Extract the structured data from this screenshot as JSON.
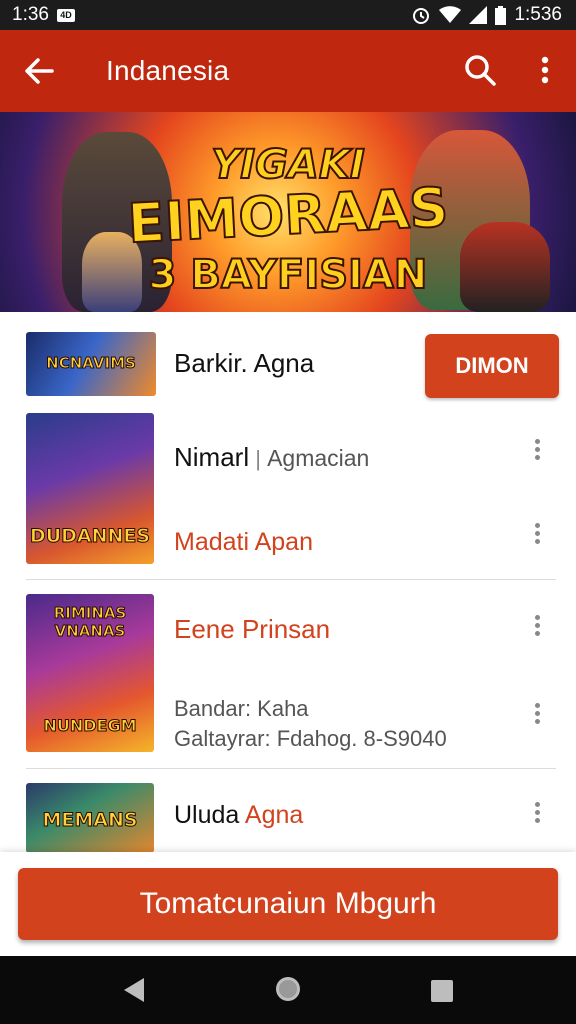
{
  "status_bar": {
    "time": "1:36",
    "notif_badge": "4D",
    "right_text": "1:536"
  },
  "app_bar": {
    "title": "Indanesia"
  },
  "banner": {
    "line1": "YIGAKI",
    "line2": "EIMORAAS",
    "line3": "3 BAYFISIAN"
  },
  "list": [
    {
      "thumb_text": "NCNAVIMS",
      "title": "Barkir. Agna",
      "action_label": "DIMON"
    },
    {
      "thumb_text": "DUDANNES",
      "title_left": "Nimarl",
      "title_sep": " | ",
      "title_right": "Agmacian",
      "subtitle": "Madati Apan"
    },
    {
      "thumb_text_top": "RIMINAS VNANAS",
      "thumb_text_bottom": "NUNDEGM",
      "title": "Eene Prinsan",
      "line2": "Bandar: Kaha",
      "line3": "Galtayrar: Fdahog. 8-S9040"
    },
    {
      "thumb_text": "MEMANS",
      "title_black": "Uluda",
      "title_orange": "Agna"
    }
  ],
  "bottom_button": {
    "label": "Tomatcunaiun Mbgurh"
  },
  "colors": {
    "primary": "#c0270f",
    "accent": "#d2421d",
    "status_bar": "#1c1c1c",
    "nav_bar": "#0a0a0a"
  },
  "icons": [
    "back-arrow-icon",
    "search-icon",
    "more-vert-icon",
    "alarm-icon",
    "wifi-icon",
    "signal-icon",
    "battery-icon",
    "nav-back-icon",
    "nav-home-icon",
    "nav-recents-icon"
  ]
}
